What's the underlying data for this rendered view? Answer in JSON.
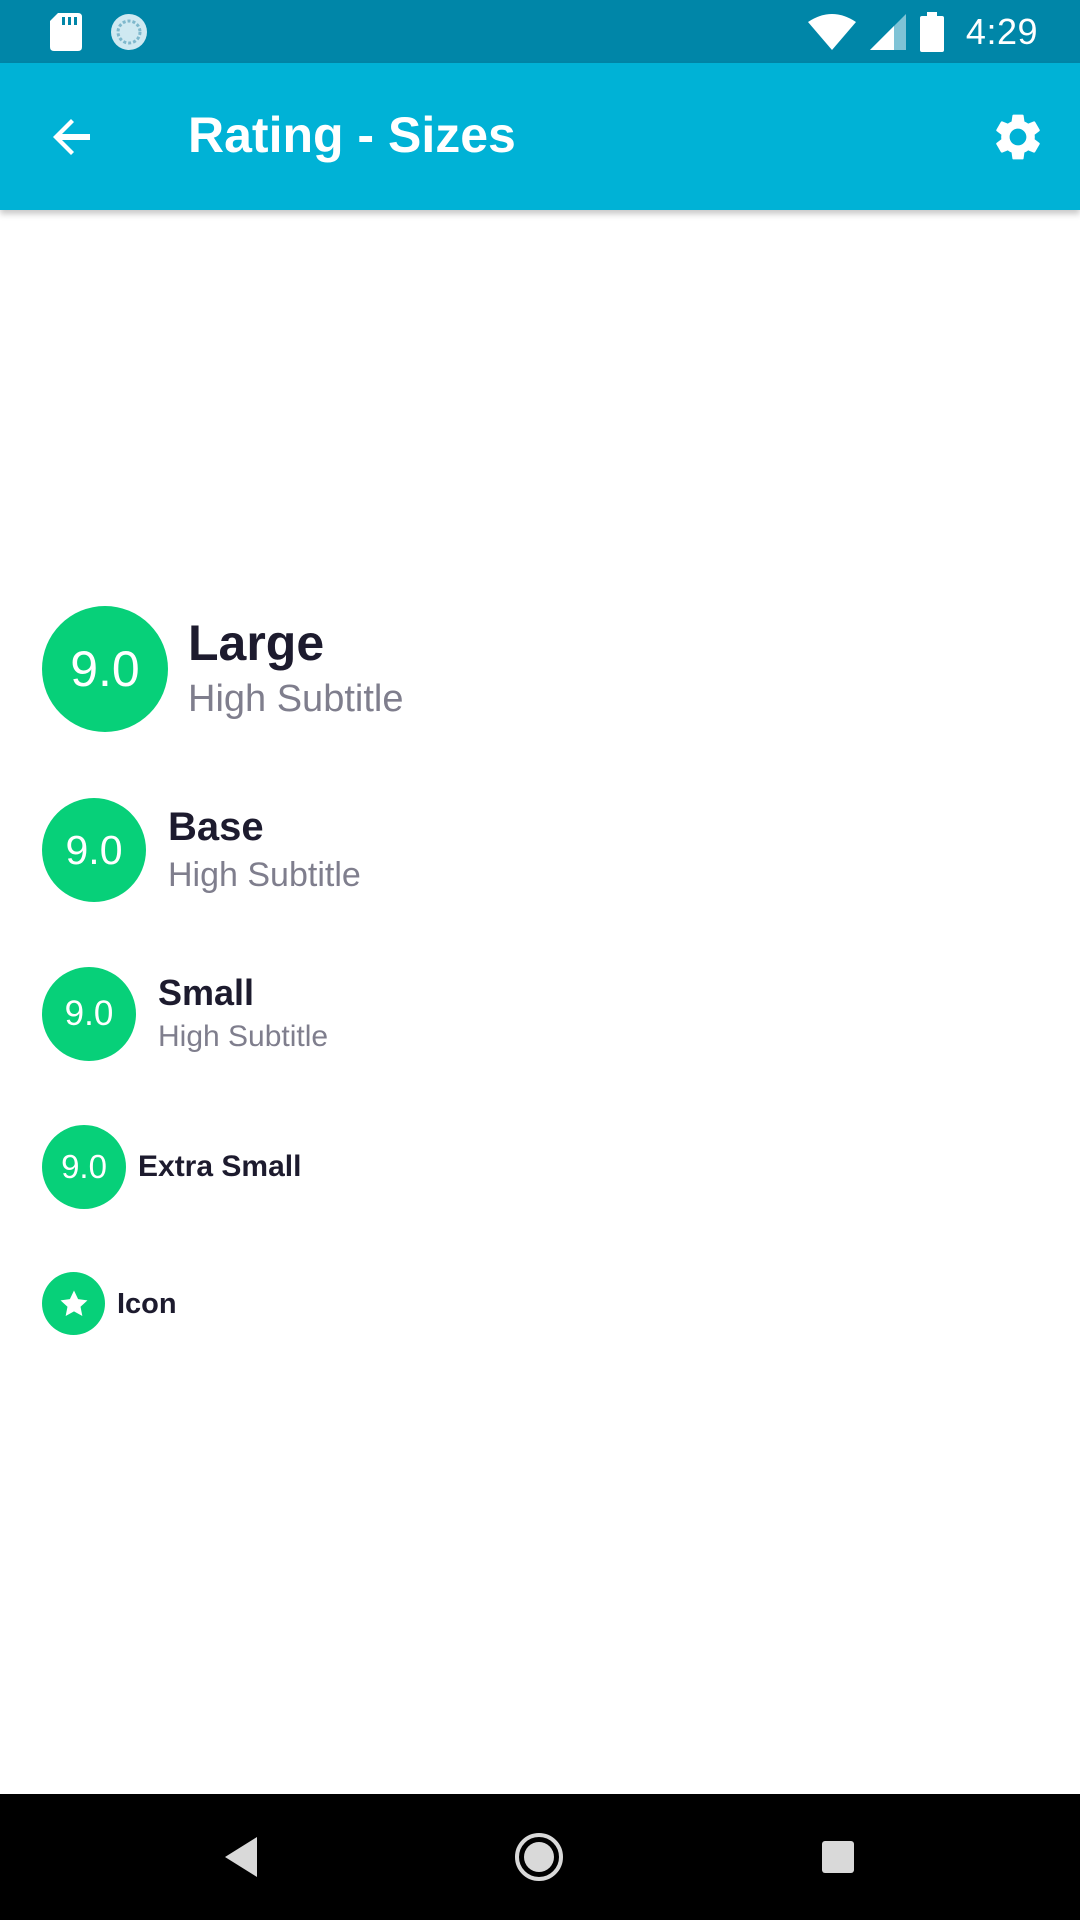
{
  "status_bar": {
    "time": "4:29",
    "icons": [
      "sd-card-icon",
      "sync-icon",
      "wifi-icon",
      "cell-signal-icon",
      "battery-icon"
    ]
  },
  "app_bar": {
    "title": "Rating - Sizes",
    "back_icon": "arrow-back-icon",
    "settings_icon": "gear-icon"
  },
  "ratings": {
    "large": {
      "score": "9.0",
      "title": "Large",
      "subtitle": "High Subtitle"
    },
    "base": {
      "score": "9.0",
      "title": "Base",
      "subtitle": "High Subtitle"
    },
    "small": {
      "score": "9.0",
      "title": "Small",
      "subtitle": "High Subtitle"
    },
    "extra_small": {
      "score": "9.0",
      "title": "Extra Small"
    },
    "icon": {
      "icon": "star-icon",
      "title": "Icon"
    }
  },
  "nav_bar": {
    "icons": [
      "nav-back-icon",
      "nav-home-icon",
      "nav-recents-icon"
    ]
  },
  "colors": {
    "status_bar": "#0086a8",
    "app_bar": "#00b2d6",
    "badge": "#07d079",
    "title_text": "#1d1b2e",
    "subtitle_text": "#7f7e8d"
  }
}
